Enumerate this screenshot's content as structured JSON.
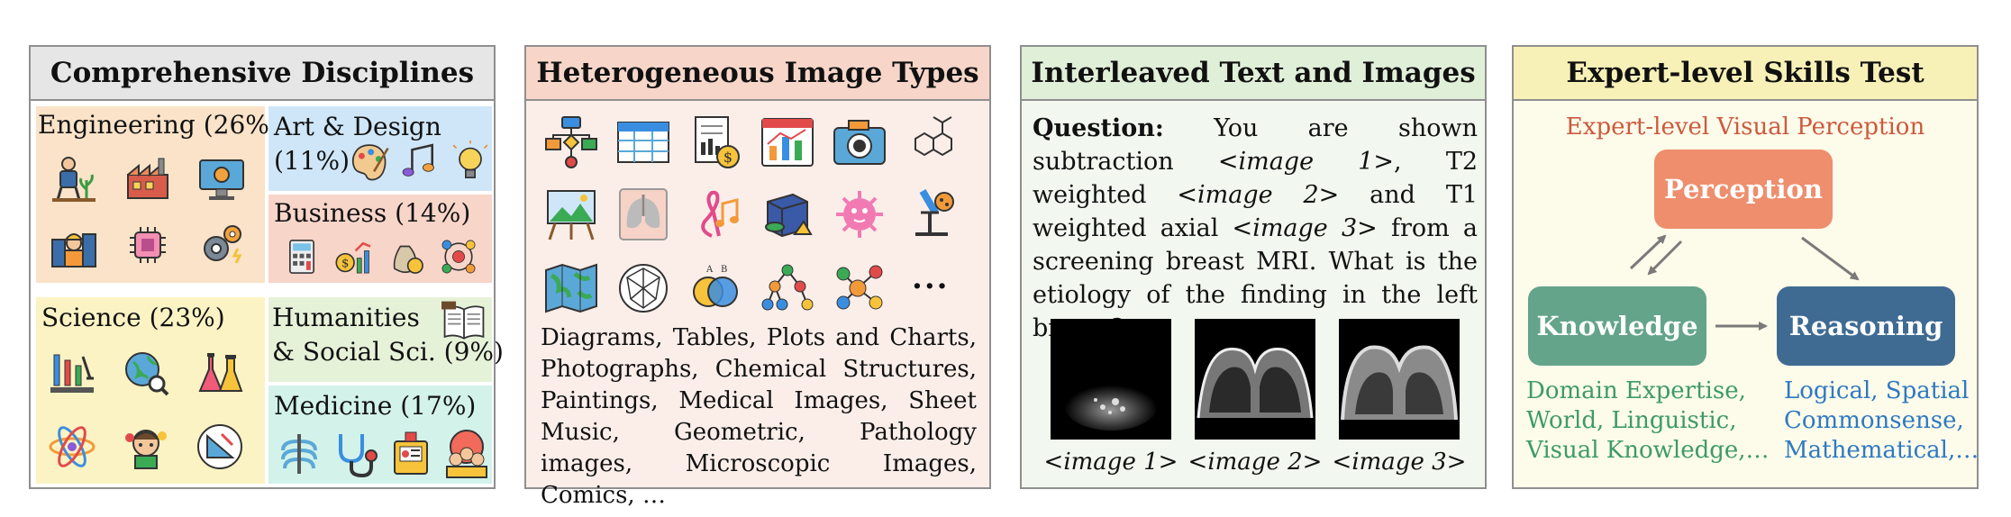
{
  "panels": {
    "disciplines": {
      "title": "Comprehensive Disciplines",
      "engineering": "Engineering (26%)",
      "art_line1": "Art & Design",
      "art_line2": "(11%)",
      "business": "Business (14%)",
      "science": "Science (23%)",
      "humanities_line1": "Humanities",
      "humanities_line2": "& Social Sci. (9%)",
      "medicine": "Medicine (17%)",
      "colors": {
        "engineering": "#fae3c8",
        "art": "#cfe6f8",
        "business": "#f8d5c9",
        "science": "#fbf3c3",
        "humanities": "#e6f2d8",
        "medicine": "#d2f2ea"
      }
    },
    "image_types": {
      "title": "Heterogeneous Image Types",
      "description": "Diagrams, Tables, Plots and Charts, Photographs, Chemical Structures, Paintings, Medical Images, Sheet Music, Geometric, Pathology images, Microscopic Images, Comics, …",
      "more_glyph": "···"
    },
    "interleaved": {
      "title": "Interleaved Text and Images",
      "question_label": "Question:",
      "q_part1": " You are shown subtraction <",
      "img1_token": "image 1",
      "q_part2": ">, T2 weighted <",
      "img2_token": "image 2",
      "q_part3": "> and T1 weighted axial <",
      "img3_token": "image 3",
      "q_part4": "> from a screening breast MRI. What is the etiology of the finding in the left breast?",
      "captions": [
        "<image 1>",
        "<image 2>",
        "<image 3>"
      ]
    },
    "skills": {
      "title": "Expert-level Skills Test",
      "visual_perception": "Expert-level Visual Perception",
      "perception": "Perception",
      "knowledge": "Knowledge",
      "reasoning": "Reasoning",
      "knowledge_desc": [
        "Domain Expertise,",
        "World, Linguistic,",
        "Visual Knowledge,…"
      ],
      "reasoning_desc": [
        "Logical, Spatial",
        "Commonsense,",
        "Mathematical,…"
      ],
      "colors": {
        "perception": "#ee8e6d",
        "knowledge": "#63a48b",
        "reasoning": "#3f6b93",
        "knowledge_text": "#3d9a6b",
        "reasoning_text": "#2e79c2"
      }
    }
  }
}
